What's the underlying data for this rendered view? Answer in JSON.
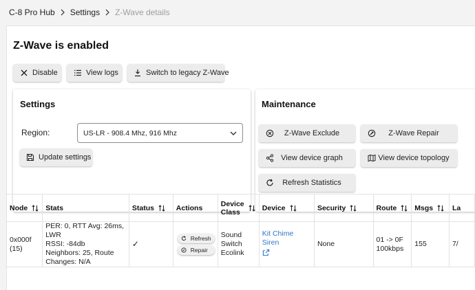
{
  "breadcrumb": {
    "items": [
      "C-8 Pro Hub",
      "Settings",
      "Z-Wave details"
    ]
  },
  "title": "Z-Wave is enabled",
  "toolbar": {
    "disable_label": "Disable",
    "view_logs_label": "View logs",
    "legacy_label": "Switch to legacy Z-Wave"
  },
  "settings": {
    "title": "Settings",
    "region_label": "Region:",
    "region_value": "US-LR - 908.4 Mhz, 916 Mhz",
    "update_label": "Update settings"
  },
  "maintenance": {
    "title": "Maintenance",
    "exclude_label": "Z-Wave Exclude",
    "repair_label": "Z-Wave Repair",
    "graph_label": "View device graph",
    "topology_label": "View device topology",
    "refresh_label": "Refresh Statistics"
  },
  "table": {
    "headers": {
      "node": "Node",
      "stats": "Stats",
      "status": "Status",
      "actions": "Actions",
      "device_class": "Device Class",
      "device": "Device",
      "security": "Security",
      "route": "Route",
      "msgs": "Msgs",
      "last": "La"
    },
    "rows": [
      {
        "node_line1": "0x000f",
        "node_line2": "(15)",
        "stats_line1": "PER: 0, RTT Avg: 26ms, LWR",
        "stats_line2": "RSSI: -84db",
        "stats_line3": "Neighbors: 25, Route",
        "stats_line4": "Changes: N/A",
        "status": "✓",
        "action_refresh": "Refresh",
        "action_repair": "Repair",
        "class_line1": "Sound",
        "class_line2": "Switch",
        "class_line3": "Ecolink",
        "device": "Kit Chime Siren",
        "security": "None",
        "route_line1": "01 -> 0F",
        "route_line2": "100kbps",
        "msgs": "155",
        "last": "7/"
      }
    ]
  },
  "colors": {
    "link": "#2d77c8",
    "muted_crumb": "#9e9e9e",
    "button_bg": "#ececec"
  }
}
